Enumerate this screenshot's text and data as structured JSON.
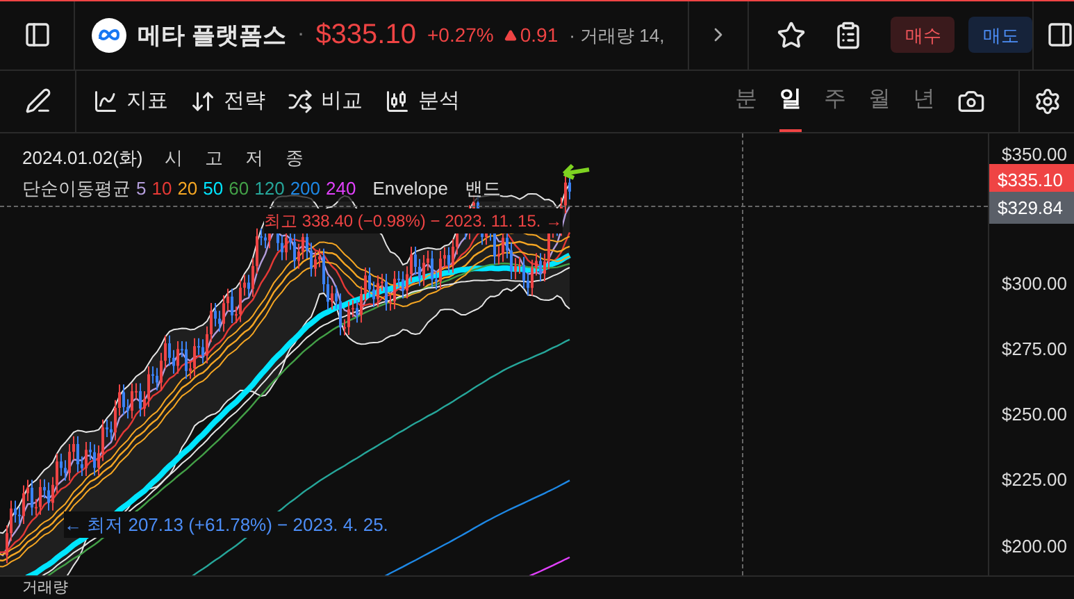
{
  "header": {
    "name": "메타 플랫폼스",
    "price": "$335.10",
    "change_pct": "+0.27%",
    "change": "0.91",
    "separator": "·",
    "volume": "· 거래량 14,",
    "buttons": [
      {
        "label": "매수",
        "kind": "buy"
      },
      {
        "label": "매도",
        "kind": "sell"
      }
    ]
  },
  "toolbar": {
    "tools": [
      {
        "label": "지표",
        "kind": "indicator"
      },
      {
        "label": "전략",
        "kind": "strategy"
      },
      {
        "label": "비교",
        "kind": "compare"
      },
      {
        "label": "분석",
        "kind": "analysis"
      }
    ],
    "intervals": [
      {
        "label": "분",
        "selected": false
      },
      {
        "label": "일",
        "selected": true
      },
      {
        "label": "주",
        "selected": false
      },
      {
        "label": "월",
        "selected": false
      },
      {
        "label": "년",
        "selected": false
      }
    ]
  },
  "legend": {
    "date": "2024.01.02(화)",
    "ohlc": [
      "시",
      "고",
      "저",
      "종"
    ],
    "ma_title": "단순이동평균",
    "ma": [
      {
        "label": "5",
        "color": "#b39ddb"
      },
      {
        "label": "10",
        "color": "#e53935"
      },
      {
        "label": "20",
        "color": "#f5a623"
      },
      {
        "label": "50",
        "color": "#00e5ff"
      },
      {
        "label": "60",
        "color": "#43a047"
      },
      {
        "label": "120",
        "color": "#26a69a"
      },
      {
        "label": "200",
        "color": "#1e88e5"
      },
      {
        "label": "240",
        "color": "#e040fb"
      }
    ],
    "envelope": "Envelope",
    "band": "밴드"
  },
  "annotations": {
    "high": "최고 338.40 (−0.98%) − 2023. 11. 15. →",
    "low": "← 최저 207.13 (+61.78%) − 2023. 4. 25."
  },
  "axis": {
    "ticks": [
      "$350.00",
      "$300.00",
      "$275.00",
      "$250.00",
      "$225.00",
      "$200.00"
    ],
    "last_price": "$335.10",
    "crosshair_price": "$329.84"
  },
  "volume_pane": {
    "title": "거래량"
  }
}
